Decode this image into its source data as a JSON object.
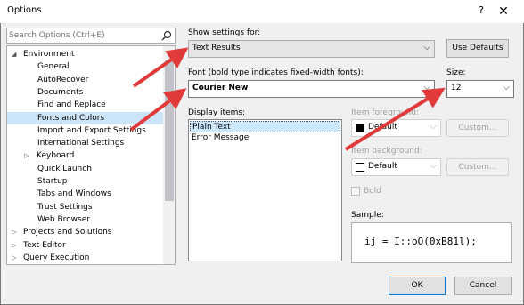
{
  "window": {
    "title": "Options",
    "help_label": "?",
    "close_label": "✕"
  },
  "search": {
    "placeholder": "Search Options (Ctrl+E)"
  },
  "tree": [
    {
      "label": "Environment",
      "arrow": "◢",
      "indent": 0
    },
    {
      "label": "General",
      "indent": 2
    },
    {
      "label": "AutoRecover",
      "indent": 2
    },
    {
      "label": "Documents",
      "indent": 2
    },
    {
      "label": "Find and Replace",
      "indent": 2
    },
    {
      "label": "Fonts and Colors",
      "indent": 2,
      "selected": true
    },
    {
      "label": "Import and Export Settings",
      "indent": 2
    },
    {
      "label": "International Settings",
      "indent": 2
    },
    {
      "label": "Keyboard",
      "arrow": "▷",
      "indent": 1
    },
    {
      "label": "Quick Launch",
      "indent": 2
    },
    {
      "label": "Startup",
      "indent": 2
    },
    {
      "label": "Tabs and Windows",
      "indent": 2
    },
    {
      "label": "Trust Settings",
      "indent": 2
    },
    {
      "label": "Web Browser",
      "indent": 2
    },
    {
      "label": "Projects and Solutions",
      "arrow": "▷",
      "indent": 0
    },
    {
      "label": "Text Editor",
      "arrow": "▷",
      "indent": 0
    },
    {
      "label": "Query Execution",
      "arrow": "▷",
      "indent": 0
    }
  ],
  "settings": {
    "show_label": "Show settings for:",
    "show_value": "Text Results",
    "use_defaults": "Use Defaults",
    "font_label": "Font (bold type indicates fixed-width fonts):",
    "font_value": "Courier New",
    "size_label": "Size:",
    "size_value": "12",
    "display_label": "Display items:",
    "display_items": [
      "Plain Text",
      "Error Message"
    ],
    "fg_label": "Item foreground:",
    "fg_value": "Default",
    "fg_swatch": "#000000",
    "custom1": "Custom...",
    "bg_label": "Item background:",
    "bg_value": "Default",
    "bg_swatch": "#ffffff",
    "custom2": "Custom...",
    "bold_label": "Bold",
    "sample_label": "Sample:",
    "sample_text": "ij = I::oO(0xB81l);"
  },
  "footer": {
    "ok": "OK",
    "cancel": "Cancel"
  },
  "colors": {
    "annotation_arrow": "#e03a3a",
    "selection": "#cce4f7",
    "accent": "#0078d7"
  }
}
